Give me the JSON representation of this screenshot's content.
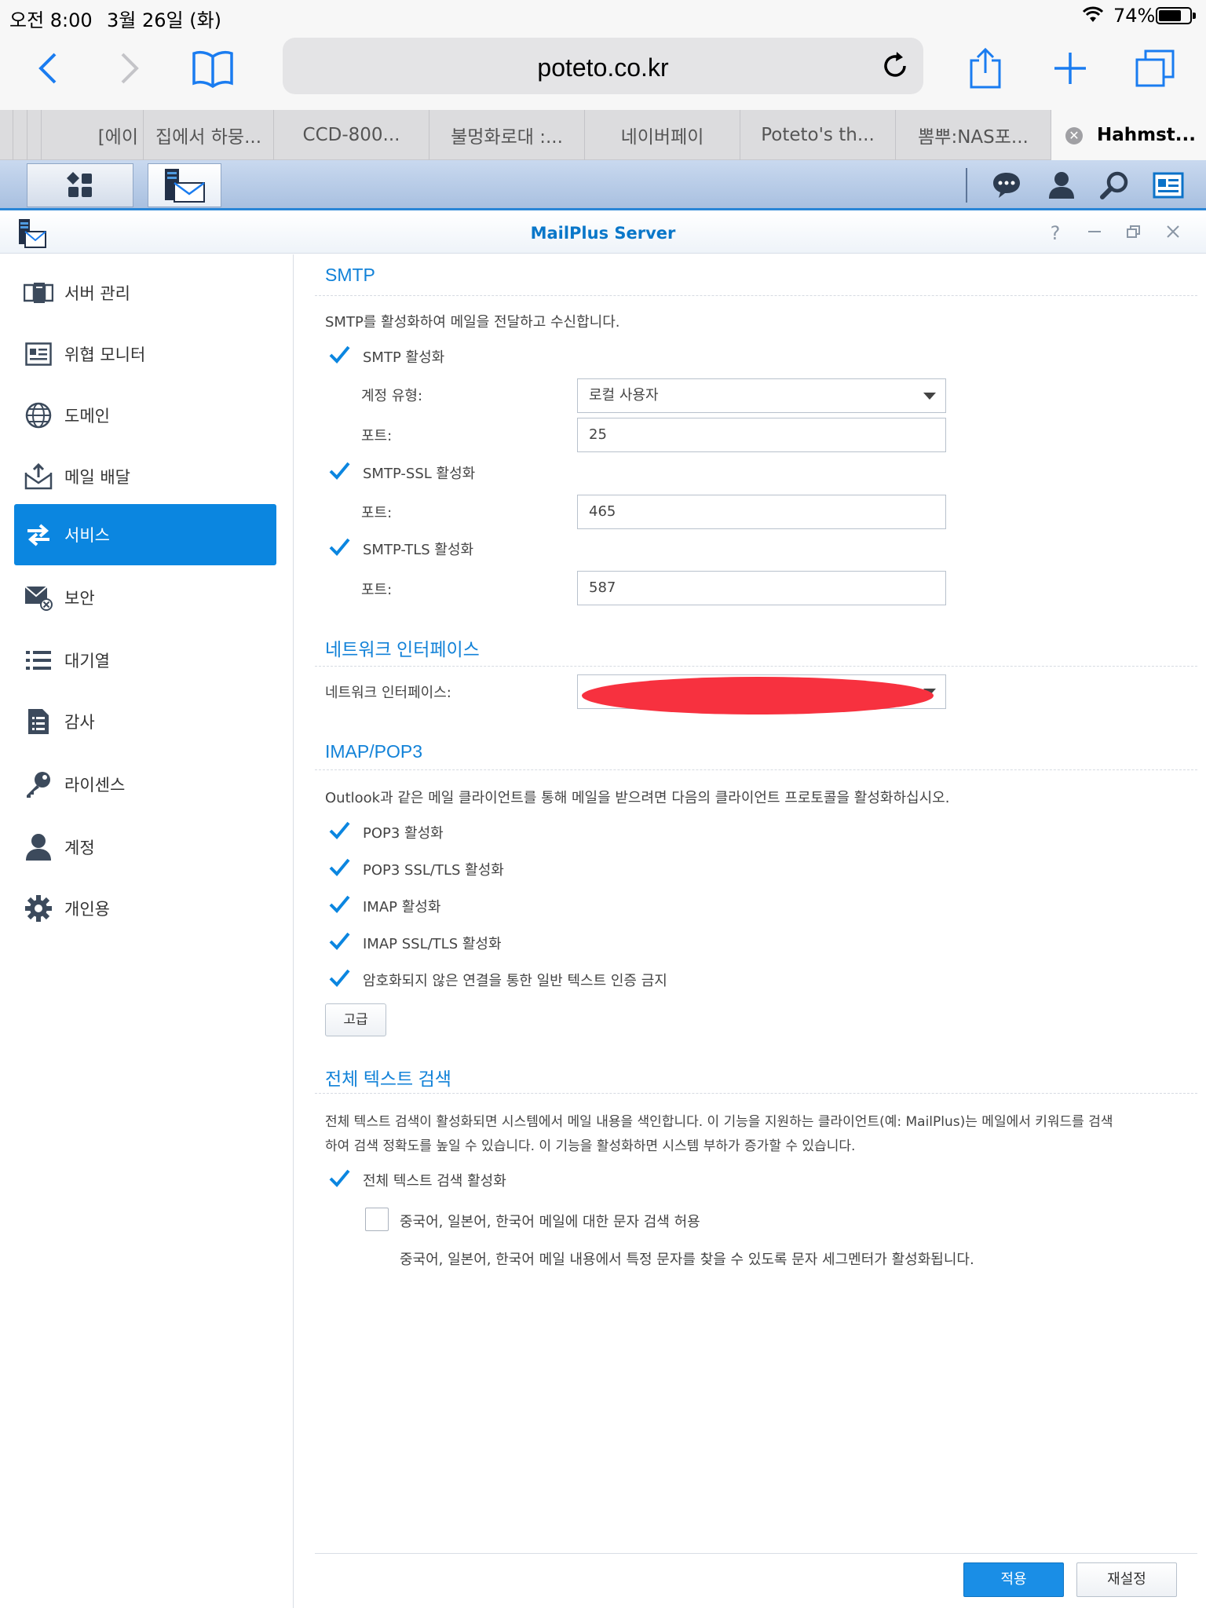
{
  "status_bar": {
    "time": "오전 8:00",
    "date": "3월 26일 (화)",
    "battery": "74%",
    "battery_level": 0.74
  },
  "browser": {
    "url": "poteto.co.kr",
    "tabs": [
      {
        "label": "[에이"
      },
      {
        "label": "집에서 하뭉..."
      },
      {
        "label": "CCD-800..."
      },
      {
        "label": "불멍화로대 :..."
      },
      {
        "label": "네이버페이"
      },
      {
        "label": "Poteto's th..."
      },
      {
        "label": "뽐뿌:NAS포..."
      },
      {
        "label": "Hahmst..."
      }
    ]
  },
  "window": {
    "title": "MailPlus Server",
    "help_glyph": "?"
  },
  "sidebar": {
    "items": [
      {
        "label": "서버 관리",
        "icon": "server-management-icon"
      },
      {
        "label": "위협 모니터",
        "icon": "threat-monitor-icon"
      },
      {
        "label": "도메인",
        "icon": "globe-icon"
      },
      {
        "label": "메일 배달",
        "icon": "mail-delivery-icon"
      },
      {
        "label": "서비스",
        "icon": "service-arrows-icon",
        "active": true
      },
      {
        "label": "보안",
        "icon": "mail-security-icon"
      },
      {
        "label": "대기열",
        "icon": "queue-list-icon"
      },
      {
        "label": "감사",
        "icon": "audit-document-icon"
      },
      {
        "label": "라이센스",
        "icon": "key-icon"
      },
      {
        "label": "계정",
        "icon": "user-icon"
      },
      {
        "label": "개인용",
        "icon": "gear-icon"
      }
    ]
  },
  "smtp": {
    "title": "SMTP",
    "description": "SMTP를 활성화하여 메일을 전달하고 수신합니다.",
    "enable_label": "SMTP 활성화",
    "enabled": true,
    "account_type_label": "계정 유형:",
    "account_type_value": "로컬 사용자",
    "port_label": "포트:",
    "port_value": "25",
    "ssl_label": "SMTP-SSL 활성화",
    "ssl_enabled": true,
    "ssl_port_label": "포트:",
    "ssl_port_value": "465",
    "tls_label": "SMTP-TLS 활성화",
    "tls_enabled": true,
    "tls_port_label": "포트:",
    "tls_port_value": "587"
  },
  "network": {
    "title": "네트워크 인터페이스",
    "label": "네트워크 인터페이스:"
  },
  "imap": {
    "title": "IMAP/POP3",
    "description": "Outlook과 같은 메일 클라이언트를 통해 메일을 받으려면 다음의 클라이언트 프로토콜을 활성화하십시오.",
    "options": [
      {
        "label": "POP3 활성화",
        "checked": true
      },
      {
        "label": "POP3 SSL/TLS 활성화",
        "checked": true
      },
      {
        "label": "IMAP 활성화",
        "checked": true
      },
      {
        "label": "IMAP SSL/TLS 활성화",
        "checked": true
      },
      {
        "label": "암호화되지 않은 연결을 통한 일반 텍스트 인증 금지",
        "checked": true
      }
    ],
    "advanced_button": "고급"
  },
  "fulltext": {
    "title": "전체 텍스트 검색",
    "description_line1": "전체 텍스트 검색이 활성화되면 시스템에서 메일 내용을 색인합니다. 이 기능을 지원하는 클라이언트(예: MailPlus)는 메일에서 키워드를 검색",
    "description_line2": "하여 검색 정확도를 높일 수 있습니다. 이 기능을 활성화하면 시스템 부하가 증가할 수 있습니다.",
    "enable_label": "전체 텍스트 검색 활성화",
    "enabled": true,
    "cjk_label": "중국어, 일본어, 한국어 메일에 대한 문자 검색 허용",
    "cjk_enabled": false,
    "cjk_note": "중국어, 일본어, 한국어 메일 내용에서 특정 문자를 찾을 수 있도록 문자 세그멘터가 활성화됩니다."
  },
  "footer": {
    "apply": "적용",
    "reset": "재설정"
  },
  "colors": {
    "accent": "#0b86e0",
    "section_title": "#1282d8",
    "redaction": "#f7313f"
  }
}
